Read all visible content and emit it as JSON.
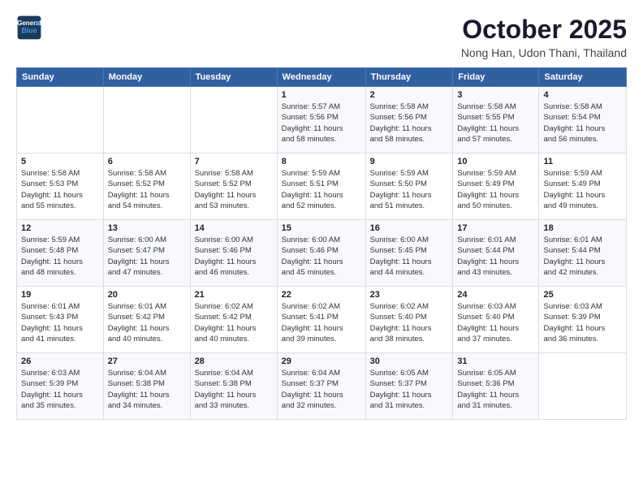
{
  "logo": {
    "line1": "General",
    "line2": "Blue"
  },
  "title": "October 2025",
  "subtitle": "Nong Han, Udon Thani, Thailand",
  "days_of_week": [
    "Sunday",
    "Monday",
    "Tuesday",
    "Wednesday",
    "Thursday",
    "Friday",
    "Saturday"
  ],
  "weeks": [
    [
      {
        "day": "",
        "info": ""
      },
      {
        "day": "",
        "info": ""
      },
      {
        "day": "",
        "info": ""
      },
      {
        "day": "1",
        "info": "Sunrise: 5:57 AM\nSunset: 5:56 PM\nDaylight: 11 hours\nand 58 minutes."
      },
      {
        "day": "2",
        "info": "Sunrise: 5:58 AM\nSunset: 5:56 PM\nDaylight: 11 hours\nand 58 minutes."
      },
      {
        "day": "3",
        "info": "Sunrise: 5:58 AM\nSunset: 5:55 PM\nDaylight: 11 hours\nand 57 minutes."
      },
      {
        "day": "4",
        "info": "Sunrise: 5:58 AM\nSunset: 5:54 PM\nDaylight: 11 hours\nand 56 minutes."
      }
    ],
    [
      {
        "day": "5",
        "info": "Sunrise: 5:58 AM\nSunset: 5:53 PM\nDaylight: 11 hours\nand 55 minutes."
      },
      {
        "day": "6",
        "info": "Sunrise: 5:58 AM\nSunset: 5:52 PM\nDaylight: 11 hours\nand 54 minutes."
      },
      {
        "day": "7",
        "info": "Sunrise: 5:58 AM\nSunset: 5:52 PM\nDaylight: 11 hours\nand 53 minutes."
      },
      {
        "day": "8",
        "info": "Sunrise: 5:59 AM\nSunset: 5:51 PM\nDaylight: 11 hours\nand 52 minutes."
      },
      {
        "day": "9",
        "info": "Sunrise: 5:59 AM\nSunset: 5:50 PM\nDaylight: 11 hours\nand 51 minutes."
      },
      {
        "day": "10",
        "info": "Sunrise: 5:59 AM\nSunset: 5:49 PM\nDaylight: 11 hours\nand 50 minutes."
      },
      {
        "day": "11",
        "info": "Sunrise: 5:59 AM\nSunset: 5:49 PM\nDaylight: 11 hours\nand 49 minutes."
      }
    ],
    [
      {
        "day": "12",
        "info": "Sunrise: 5:59 AM\nSunset: 5:48 PM\nDaylight: 11 hours\nand 48 minutes."
      },
      {
        "day": "13",
        "info": "Sunrise: 6:00 AM\nSunset: 5:47 PM\nDaylight: 11 hours\nand 47 minutes."
      },
      {
        "day": "14",
        "info": "Sunrise: 6:00 AM\nSunset: 5:46 PM\nDaylight: 11 hours\nand 46 minutes."
      },
      {
        "day": "15",
        "info": "Sunrise: 6:00 AM\nSunset: 5:46 PM\nDaylight: 11 hours\nand 45 minutes."
      },
      {
        "day": "16",
        "info": "Sunrise: 6:00 AM\nSunset: 5:45 PM\nDaylight: 11 hours\nand 44 minutes."
      },
      {
        "day": "17",
        "info": "Sunrise: 6:01 AM\nSunset: 5:44 PM\nDaylight: 11 hours\nand 43 minutes."
      },
      {
        "day": "18",
        "info": "Sunrise: 6:01 AM\nSunset: 5:44 PM\nDaylight: 11 hours\nand 42 minutes."
      }
    ],
    [
      {
        "day": "19",
        "info": "Sunrise: 6:01 AM\nSunset: 5:43 PM\nDaylight: 11 hours\nand 41 minutes."
      },
      {
        "day": "20",
        "info": "Sunrise: 6:01 AM\nSunset: 5:42 PM\nDaylight: 11 hours\nand 40 minutes."
      },
      {
        "day": "21",
        "info": "Sunrise: 6:02 AM\nSunset: 5:42 PM\nDaylight: 11 hours\nand 40 minutes."
      },
      {
        "day": "22",
        "info": "Sunrise: 6:02 AM\nSunset: 5:41 PM\nDaylight: 11 hours\nand 39 minutes."
      },
      {
        "day": "23",
        "info": "Sunrise: 6:02 AM\nSunset: 5:40 PM\nDaylight: 11 hours\nand 38 minutes."
      },
      {
        "day": "24",
        "info": "Sunrise: 6:03 AM\nSunset: 5:40 PM\nDaylight: 11 hours\nand 37 minutes."
      },
      {
        "day": "25",
        "info": "Sunrise: 6:03 AM\nSunset: 5:39 PM\nDaylight: 11 hours\nand 36 minutes."
      }
    ],
    [
      {
        "day": "26",
        "info": "Sunrise: 6:03 AM\nSunset: 5:39 PM\nDaylight: 11 hours\nand 35 minutes."
      },
      {
        "day": "27",
        "info": "Sunrise: 6:04 AM\nSunset: 5:38 PM\nDaylight: 11 hours\nand 34 minutes."
      },
      {
        "day": "28",
        "info": "Sunrise: 6:04 AM\nSunset: 5:38 PM\nDaylight: 11 hours\nand 33 minutes."
      },
      {
        "day": "29",
        "info": "Sunrise: 6:04 AM\nSunset: 5:37 PM\nDaylight: 11 hours\nand 32 minutes."
      },
      {
        "day": "30",
        "info": "Sunrise: 6:05 AM\nSunset: 5:37 PM\nDaylight: 11 hours\nand 31 minutes."
      },
      {
        "day": "31",
        "info": "Sunrise: 6:05 AM\nSunset: 5:36 PM\nDaylight: 11 hours\nand 31 minutes."
      },
      {
        "day": "",
        "info": ""
      }
    ]
  ]
}
